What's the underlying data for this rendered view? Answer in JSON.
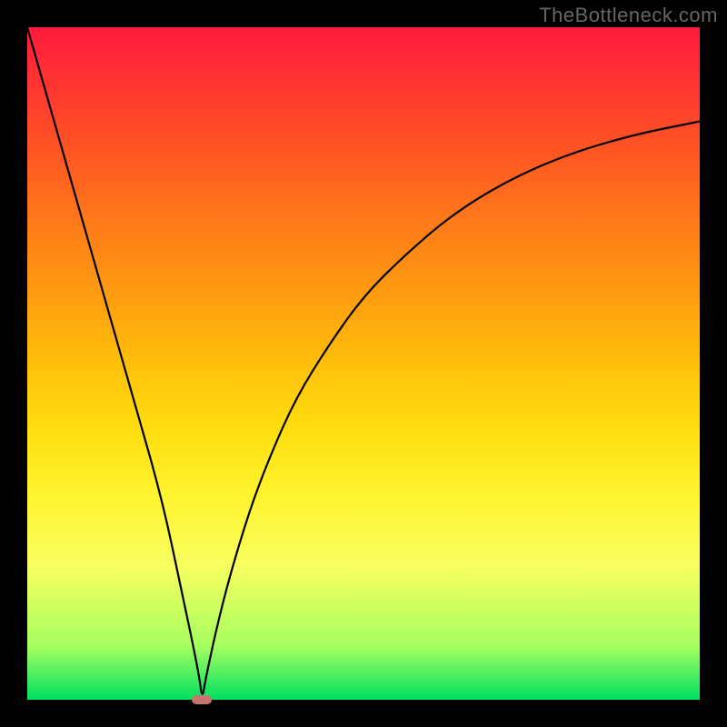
{
  "watermark": "TheBottleneck.com",
  "chart_data": {
    "type": "line",
    "title": "",
    "xlabel": "",
    "ylabel": "",
    "xlim": [
      0,
      100
    ],
    "ylim": [
      0,
      100
    ],
    "grid": false,
    "series": [
      {
        "name": "curve",
        "x": [
          0,
          4,
          8,
          12,
          16,
          20,
          23,
          25.5,
          26,
          26.5,
          28,
          30,
          33,
          36,
          40,
          45,
          50,
          56,
          63,
          71,
          80,
          90,
          100
        ],
        "y": [
          100,
          86,
          72,
          58,
          44,
          30,
          16,
          4,
          0,
          3,
          10,
          18,
          28,
          36,
          45,
          53,
          60,
          66,
          72,
          77,
          81,
          84,
          86
        ]
      }
    ],
    "marker": {
      "x": 26,
      "y": 0
    },
    "background_gradient": [
      "#ff1a3c",
      "#00e060"
    ]
  }
}
